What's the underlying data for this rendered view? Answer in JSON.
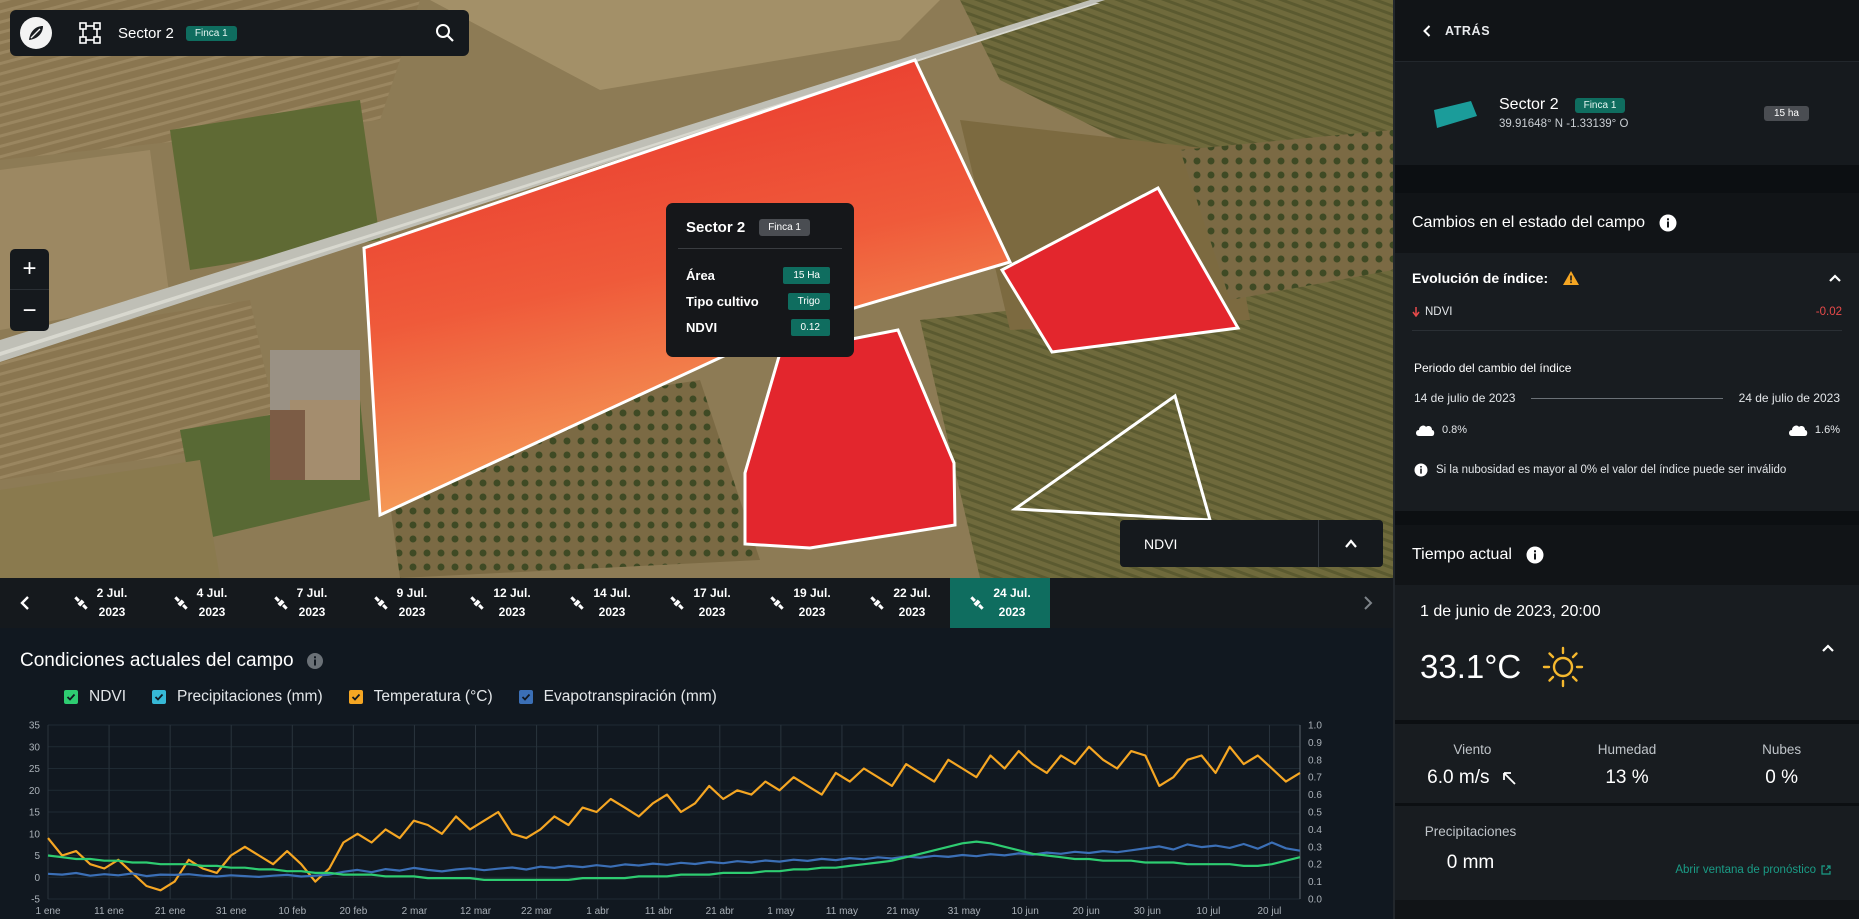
{
  "topbar": {
    "title": "Sector 2",
    "badge": "Finca 1"
  },
  "zoom": {
    "in_label": "+",
    "out_label": "−"
  },
  "tooltip": {
    "title": "Sector 2",
    "badge": "Finca 1",
    "rows": [
      {
        "label": "Área",
        "value": "15 Ha"
      },
      {
        "label": "Tipo cultivo",
        "value": "Trigo"
      },
      {
        "label": "NDVI",
        "value": "0.12"
      }
    ]
  },
  "layer_selector": {
    "label": "NDVI"
  },
  "timeline": {
    "dates": [
      {
        "day": "2 Jul.",
        "year": "2023"
      },
      {
        "day": "4 Jul.",
        "year": "2023"
      },
      {
        "day": "7 Jul.",
        "year": "2023"
      },
      {
        "day": "9 Jul.",
        "year": "2023"
      },
      {
        "day": "12 Jul.",
        "year": "2023"
      },
      {
        "day": "14 Jul.",
        "year": "2023"
      },
      {
        "day": "17 Jul.",
        "year": "2023"
      },
      {
        "day": "19 Jul.",
        "year": "2023"
      },
      {
        "day": "22 Jul.",
        "year": "2023"
      },
      {
        "day": "24 Jul.",
        "year": "2023"
      }
    ],
    "active_index": 9
  },
  "conditions": {
    "title": "Condiciones actuales del campo",
    "legend": [
      {
        "label": "NDVI",
        "color": "#2ecc71"
      },
      {
        "label": "Precipitaciones (mm)",
        "color": "#36b8d6"
      },
      {
        "label": "Temperatura (°C)",
        "color": "#f5a623"
      },
      {
        "label": "Evapotranspiración (mm)",
        "color": "#3b6fb6"
      }
    ]
  },
  "chart_data": {
    "type": "line",
    "title": "",
    "x_ticks": [
      "1 ene",
      "11 ene",
      "21 ene",
      "31 ene",
      "10 feb",
      "20 feb",
      "2 mar",
      "12 mar",
      "22 mar",
      "1 abr",
      "11 abr",
      "21 abr",
      "1 may",
      "11 may",
      "21 may",
      "31 may",
      "10 jun",
      "20 jun",
      "30 jun",
      "10 jul",
      "20 jul"
    ],
    "y_left": {
      "ticks": [
        "35",
        "30",
        "25",
        "20",
        "15",
        "10",
        "5",
        "0",
        "-5"
      ],
      "ylim": [
        -5,
        35
      ]
    },
    "y_right": {
      "ticks": [
        "1.0",
        "0.9",
        "0.8",
        "0.7",
        "0.6",
        "0.5",
        "0.4",
        "0.3",
        "0.2",
        "0.1",
        "0.0"
      ],
      "ylim": [
        0,
        1
      ]
    },
    "series": [
      {
        "name": "Temperatura (°C)",
        "type": "line",
        "color": "#f5a623",
        "values": [
          9,
          5,
          6,
          3,
          2,
          4,
          1,
          -2,
          -3,
          -1,
          4,
          2,
          1,
          5,
          7,
          5,
          3,
          6,
          3,
          -1,
          2,
          8,
          10,
          8,
          11,
          9,
          13,
          12,
          10,
          14,
          11,
          13,
          15,
          10,
          9,
          11,
          14,
          12,
          16,
          15,
          18,
          16,
          14,
          17,
          19,
          15,
          17,
          21,
          18,
          20,
          19,
          22,
          20,
          23,
          21,
          19,
          24,
          22,
          25,
          23,
          21,
          26,
          24,
          22,
          27,
          25,
          23,
          28,
          25,
          29,
          26,
          24,
          28,
          26,
          30,
          27,
          25,
          29,
          28,
          21,
          23,
          27,
          28,
          24,
          30,
          26,
          28,
          25,
          22,
          24
        ]
      },
      {
        "name": "Evapotranspiración (mm)",
        "type": "line",
        "color": "#3b6fb6",
        "values": [
          2,
          1.8,
          2.2,
          1.5,
          1.9,
          1.6,
          2.1,
          1.4,
          1.8,
          1.7,
          1.9,
          1.5,
          1.3,
          1.6,
          1.4,
          1.2,
          1.5,
          1.7,
          1.3,
          1.5,
          1.8,
          2.5,
          3,
          2.4,
          3.2,
          2.8,
          3.5,
          3,
          2.6,
          3.1,
          3.4,
          2.9,
          3.3,
          3.6,
          3.1,
          3.8,
          3.5,
          4,
          3.7,
          4.2,
          3.8,
          4.4,
          4.1,
          4.6,
          4.3,
          4.8,
          4.5,
          5,
          4.7,
          5.2,
          4.9,
          5.4,
          5.1,
          5.6,
          5.3,
          5.8,
          5.5,
          6,
          5.7,
          6.2,
          5.9,
          6.4,
          6.1,
          6.6,
          6.3,
          6.8,
          6.5,
          7,
          6.7,
          7.2,
          6.9,
          7.4,
          7.1,
          7.6,
          7.3,
          7.8,
          7.5,
          8,
          8.5,
          9,
          8.2,
          9.5,
          8.8,
          9.2,
          8.6,
          9.6,
          8.4,
          10,
          8.5,
          7.9
        ]
      },
      {
        "name": "NDVI",
        "type": "line",
        "color": "#2ecc71",
        "values": [
          0.25,
          0.24,
          0.23,
          0.23,
          0.22,
          0.22,
          0.21,
          0.21,
          0.2,
          0.2,
          0.2,
          0.19,
          0.19,
          0.18,
          0.18,
          0.17,
          0.17,
          0.16,
          0.16,
          0.15,
          0.15,
          0.14,
          0.14,
          0.14,
          0.13,
          0.13,
          0.13,
          0.12,
          0.12,
          0.12,
          0.12,
          0.11,
          0.11,
          0.11,
          0.11,
          0.11,
          0.11,
          0.11,
          0.12,
          0.12,
          0.12,
          0.12,
          0.13,
          0.13,
          0.13,
          0.14,
          0.14,
          0.14,
          0.15,
          0.15,
          0.15,
          0.16,
          0.16,
          0.17,
          0.17,
          0.18,
          0.18,
          0.19,
          0.2,
          0.21,
          0.22,
          0.24,
          0.26,
          0.28,
          0.3,
          0.32,
          0.33,
          0.32,
          0.3,
          0.28,
          0.26,
          0.25,
          0.24,
          0.23,
          0.23,
          0.22,
          0.22,
          0.22,
          0.21,
          0.21,
          0.21,
          0.2,
          0.2,
          0.2,
          0.2,
          0.19,
          0.19,
          0.2,
          0.22,
          0.24
        ]
      },
      {
        "name": "Precipitaciones (mm)",
        "type": "bar",
        "color": "#36b8d6",
        "values": [
          0,
          0,
          0,
          0,
          0,
          0,
          0,
          0,
          0,
          0,
          0,
          0,
          0,
          0,
          0,
          0,
          0,
          0,
          0,
          0,
          0,
          0,
          0,
          0,
          0,
          0,
          0,
          0,
          0,
          0,
          0,
          0,
          0,
          0,
          0,
          0,
          0,
          0,
          0,
          0,
          0,
          0,
          0,
          0,
          0,
          0,
          0,
          0,
          0,
          0,
          0,
          0,
          0,
          0,
          0,
          0,
          0,
          0,
          0,
          0,
          0,
          0,
          0,
          0,
          0,
          0,
          0,
          0,
          0,
          0,
          0,
          0,
          0,
          0,
          0,
          0,
          0,
          0,
          0,
          0,
          0,
          0,
          0,
          0,
          0,
          0,
          0,
          0,
          0,
          0
        ]
      }
    ]
  },
  "side": {
    "back_label": "ATRÁS",
    "sector": {
      "name": "Sector 2",
      "badge": "Finca 1",
      "coords": "39.91648° N -1.33139° O",
      "area": "15 ha"
    },
    "changes": {
      "title": "Cambios en el estado del campo",
      "evolution_label": "Evolución de índice:",
      "index_name": "NDVI",
      "index_delta": "-0.02",
      "period_title": "Periodo del cambio del índice",
      "start_date": "14 de julio de 2023",
      "end_date": "24 de julio de 2023",
      "start_cloud": "0.8%",
      "end_cloud": "1.6%",
      "note": "Si la nubosidad es mayor al 0% el valor del índice puede ser inválido"
    },
    "weather": {
      "title": "Tiempo actual",
      "datetime": "1 de junio de 2023, 20:00",
      "temperature": "33.1°C",
      "wind_label": "Viento",
      "wind_value": "6.0 m/s",
      "humidity_label": "Humedad",
      "humidity_value": "13 %",
      "clouds_label": "Nubes",
      "clouds_value": "0 %",
      "precip_label": "Precipitaciones",
      "precip_value": "0 mm",
      "forecast_link": "Abrir ventana de pronóstico"
    }
  }
}
